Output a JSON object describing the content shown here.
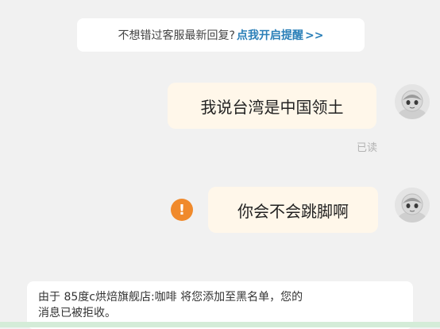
{
  "notice": {
    "text": "不想错过客服最新回复?",
    "link": "点我开启提醒",
    "arrow": ">>"
  },
  "messages": [
    {
      "text": "我说台湾是中国领土",
      "status": "已读"
    },
    {
      "text": "你会不会跳脚啊",
      "status_icon": "!"
    }
  ],
  "system_notice": {
    "line1": "由于  85度c烘焙旗舰店:咖啡  将您添加至黑名单，您的",
    "line2": "消息已被拒收。"
  },
  "icons": {
    "avatar": "user-avatar-icon",
    "fail": "exclamation-icon"
  },
  "colors": {
    "background": "#f1f1f1",
    "bubble": "#fff7ea",
    "link": "#2a7fb8",
    "fail": "#f08a2c"
  }
}
